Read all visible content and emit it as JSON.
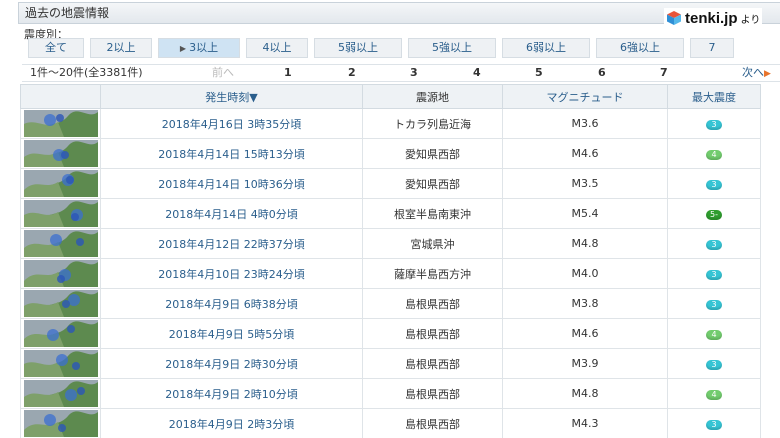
{
  "header": {
    "title": "過去の地震情報"
  },
  "logo": {
    "name": "tenki.jp",
    "suffix": "より"
  },
  "filter": {
    "label": "震度別：",
    "options": [
      "全て",
      "2以上",
      "3以上",
      "4以上",
      "5弱以上",
      "5強以上",
      "6弱以上",
      "6強以上",
      "7"
    ],
    "selected": "3以上"
  },
  "pagination": {
    "count_text": "1件～20件(全3381件)",
    "prev_label": "前へ",
    "pages": [
      "1",
      "2",
      "3",
      "4",
      "5",
      "6",
      "7"
    ],
    "next_label": "次へ"
  },
  "table": {
    "headers": {
      "time": "発生時刻▼",
      "epicenter": "震源地",
      "magnitude": "マグニチュード",
      "intensity": "最大震度"
    },
    "rows": [
      {
        "time": "2018年4月16日 3時35分頃",
        "epicenter": "トカラ列島近海",
        "magnitude": "M3.6",
        "intensity": "3",
        "badge_color": "#35c4d4"
      },
      {
        "time": "2018年4月14日 15時13分頃",
        "epicenter": "愛知県西部",
        "magnitude": "M4.6",
        "intensity": "4",
        "badge_color": "#72cc6e"
      },
      {
        "time": "2018年4月14日 10時36分頃",
        "epicenter": "愛知県西部",
        "magnitude": "M3.5",
        "intensity": "3",
        "badge_color": "#35c4d4"
      },
      {
        "time": "2018年4月14日 4時0分頃",
        "epicenter": "根室半島南東沖",
        "magnitude": "M5.4",
        "intensity": "5-",
        "badge_color": "#2e9d2e"
      },
      {
        "time": "2018年4月12日 22時37分頃",
        "epicenter": "宮城県沖",
        "magnitude": "M4.8",
        "intensity": "3",
        "badge_color": "#35c4d4"
      },
      {
        "time": "2018年4月10日 23時24分頃",
        "epicenter": "薩摩半島西方沖",
        "magnitude": "M4.0",
        "intensity": "3",
        "badge_color": "#35c4d4"
      },
      {
        "time": "2018年4月9日 6時38分頃",
        "epicenter": "島根県西部",
        "magnitude": "M3.8",
        "intensity": "3",
        "badge_color": "#35c4d4"
      },
      {
        "time": "2018年4月9日 5時5分頃",
        "epicenter": "島根県西部",
        "magnitude": "M4.6",
        "intensity": "4",
        "badge_color": "#72cc6e"
      },
      {
        "time": "2018年4月9日 2時30分頃",
        "epicenter": "島根県西部",
        "magnitude": "M3.9",
        "intensity": "3",
        "badge_color": "#35c4d4"
      },
      {
        "time": "2018年4月9日 2時10分頃",
        "epicenter": "島根県西部",
        "magnitude": "M4.8",
        "intensity": "4",
        "badge_color": "#72cc6e"
      },
      {
        "time": "2018年4月9日 2時3分頃",
        "epicenter": "島根県西部",
        "magnitude": "M4.3",
        "intensity": "3",
        "badge_color": "#35c4d4"
      }
    ]
  }
}
